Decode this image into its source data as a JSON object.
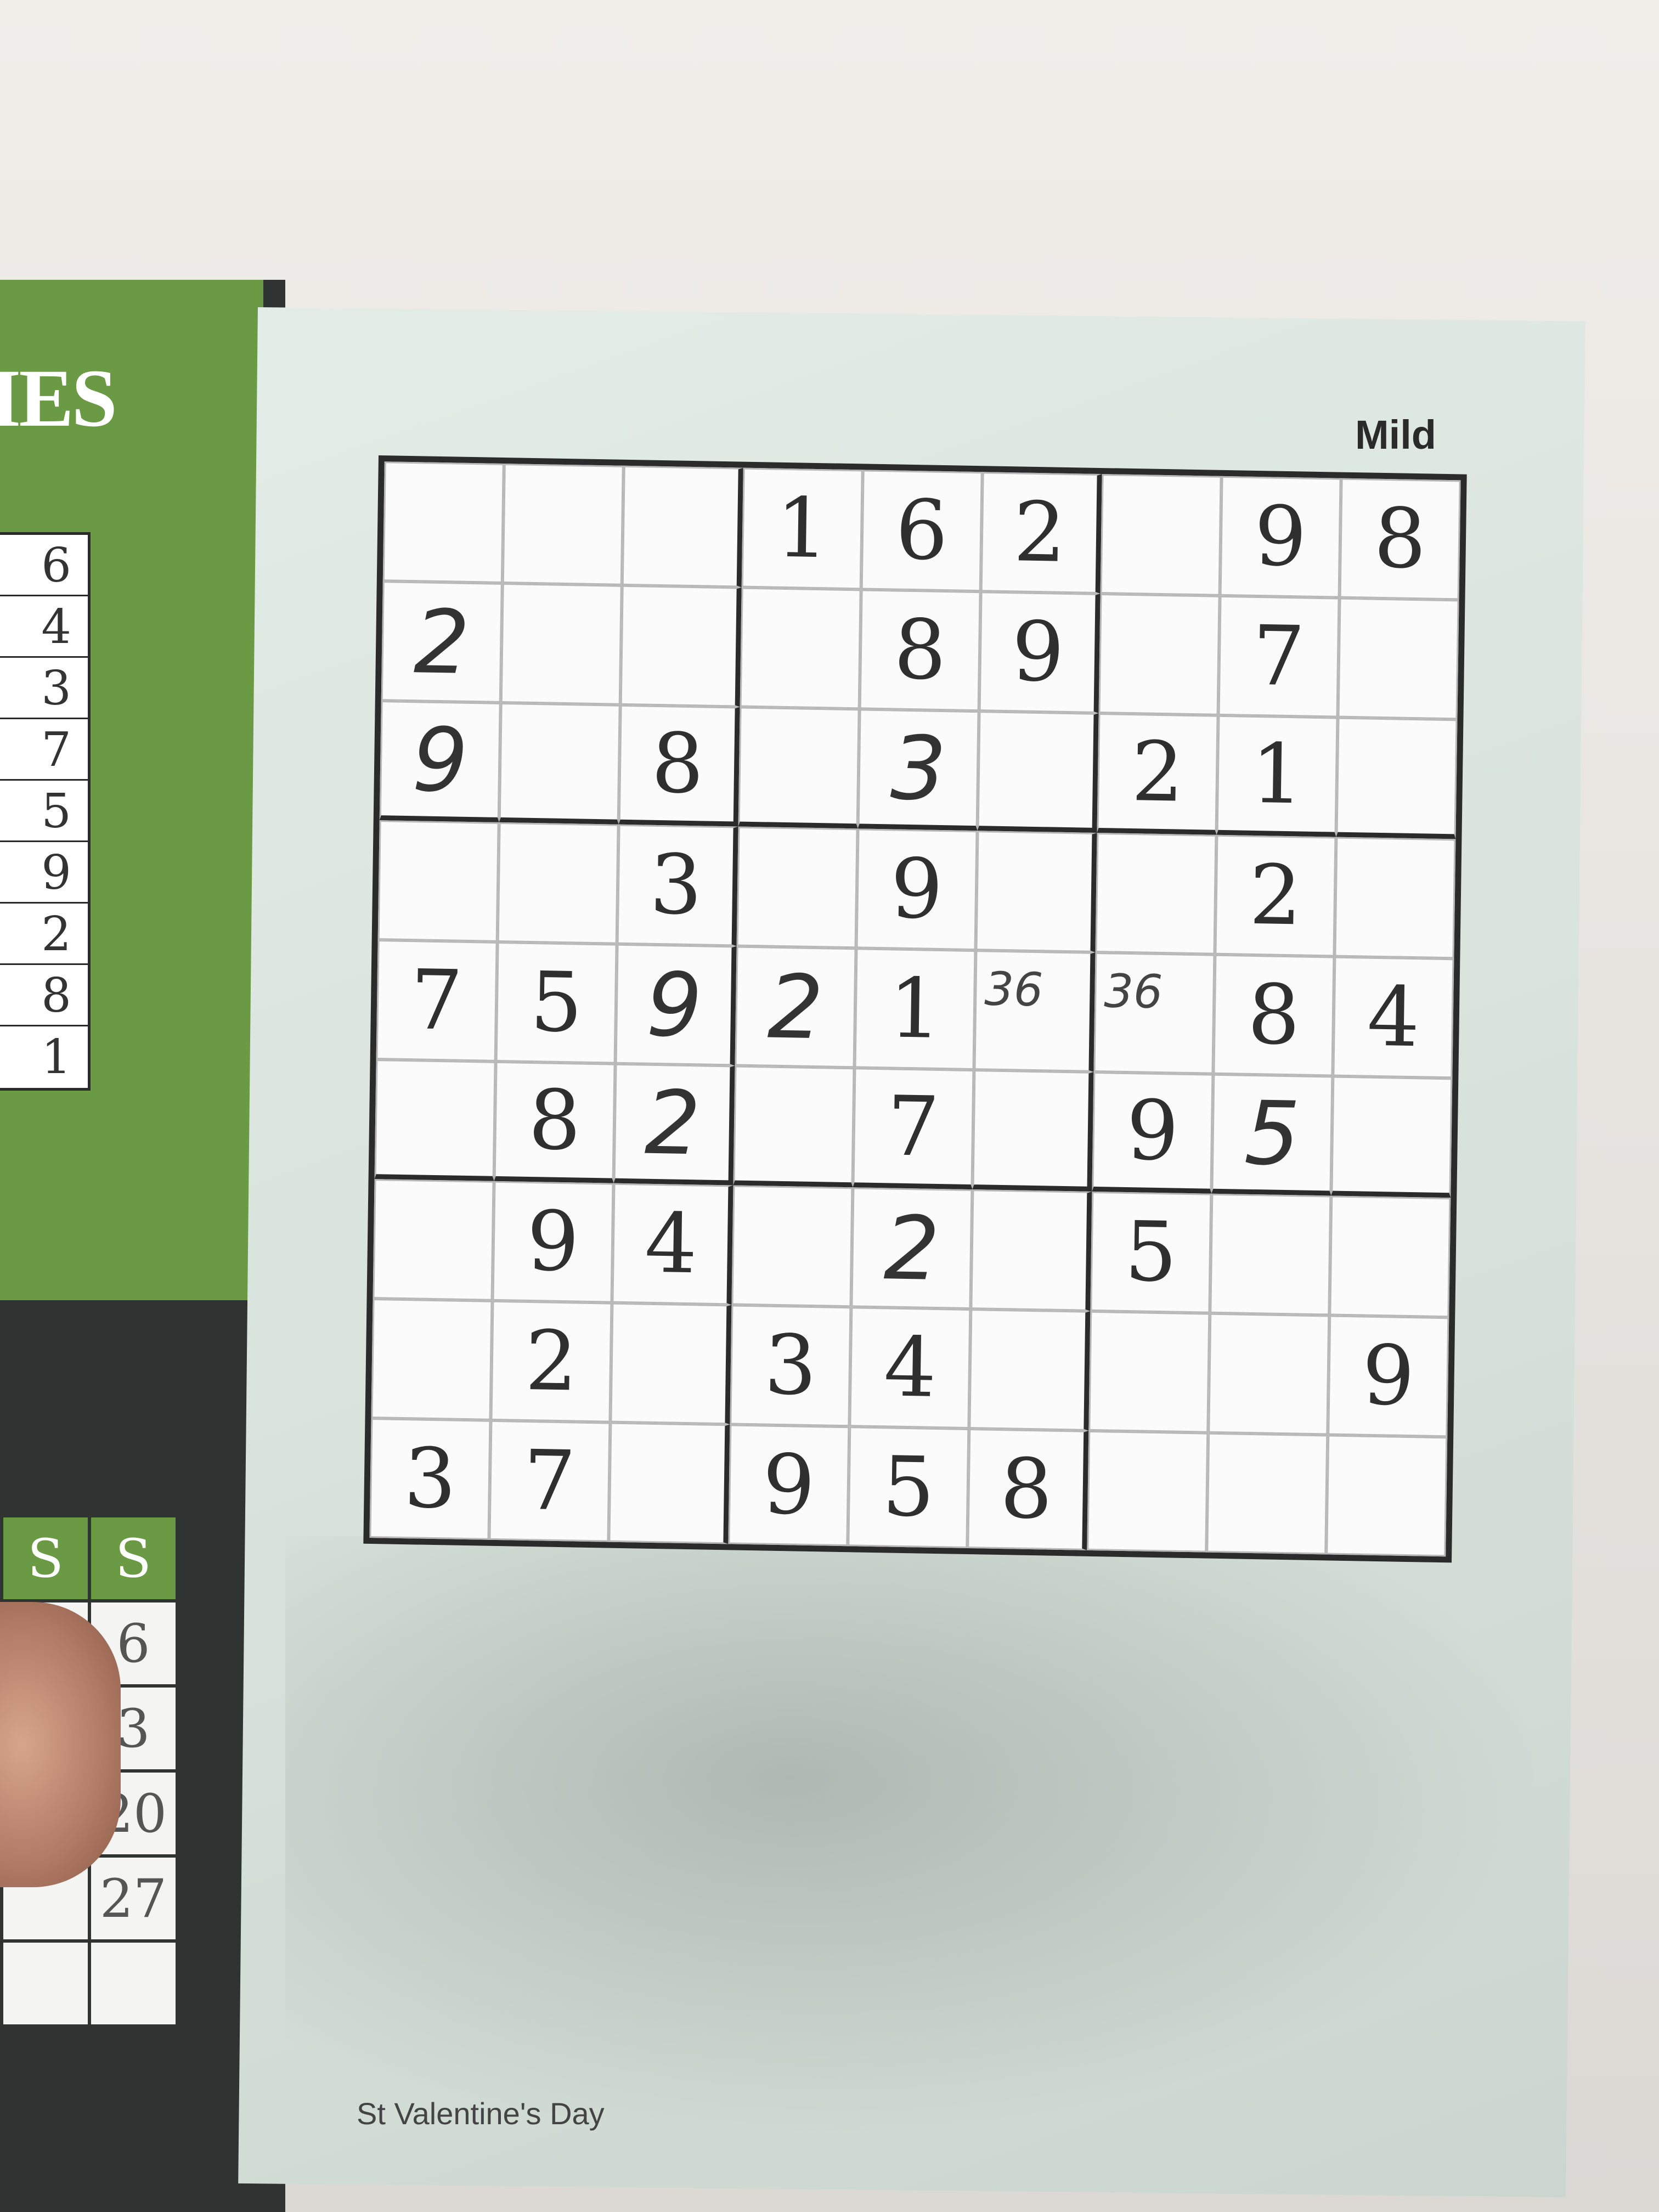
{
  "left_page": {
    "header": "IES",
    "answer_strip": [
      "6",
      "4",
      "3",
      "7",
      "5",
      "9",
      "2",
      "8",
      "1"
    ],
    "calendar": {
      "headers": [
        "S",
        "S"
      ],
      "rows": [
        [
          "",
          "6"
        ],
        [
          "",
          "3"
        ],
        [
          "",
          "20"
        ],
        [
          "",
          "27"
        ],
        [
          "",
          ""
        ]
      ]
    }
  },
  "puzzle": {
    "difficulty": "Mild",
    "grid": [
      [
        "",
        "",
        "",
        "1",
        "6",
        "2",
        "",
        "9",
        "8"
      ],
      [
        "2",
        "",
        "",
        "",
        "8",
        "9",
        "",
        "7",
        ""
      ],
      [
        "9",
        "",
        "8",
        "",
        "3",
        "",
        "2",
        "1",
        ""
      ],
      [
        "",
        "",
        "3",
        "",
        "9",
        "",
        "",
        "2",
        ""
      ],
      [
        "7",
        "5",
        "9",
        "2",
        "1",
        "",
        "",
        "8",
        "4"
      ],
      [
        "",
        "8",
        "2",
        "",
        "7",
        "",
        "9",
        "5",
        ""
      ],
      [
        "",
        "9",
        "4",
        "",
        "2",
        "",
        "5",
        "",
        ""
      ],
      [
        "",
        "2",
        "",
        "3",
        "4",
        "",
        "",
        "",
        "9"
      ],
      [
        "3",
        "7",
        "",
        "9",
        "5",
        "8",
        "",
        "",
        ""
      ]
    ],
    "handwritten": [
      [
        1,
        0
      ],
      [
        2,
        0
      ],
      [
        2,
        4
      ],
      [
        4,
        2
      ],
      [
        4,
        3
      ],
      [
        5,
        2
      ],
      [
        5,
        7
      ],
      [
        6,
        4
      ]
    ],
    "pencil_marks": [
      {
        "row": 4,
        "col": 5,
        "text": "36"
      },
      {
        "row": 4,
        "col": 6,
        "text": "36"
      }
    ],
    "footer": "St Valentine's Day"
  }
}
